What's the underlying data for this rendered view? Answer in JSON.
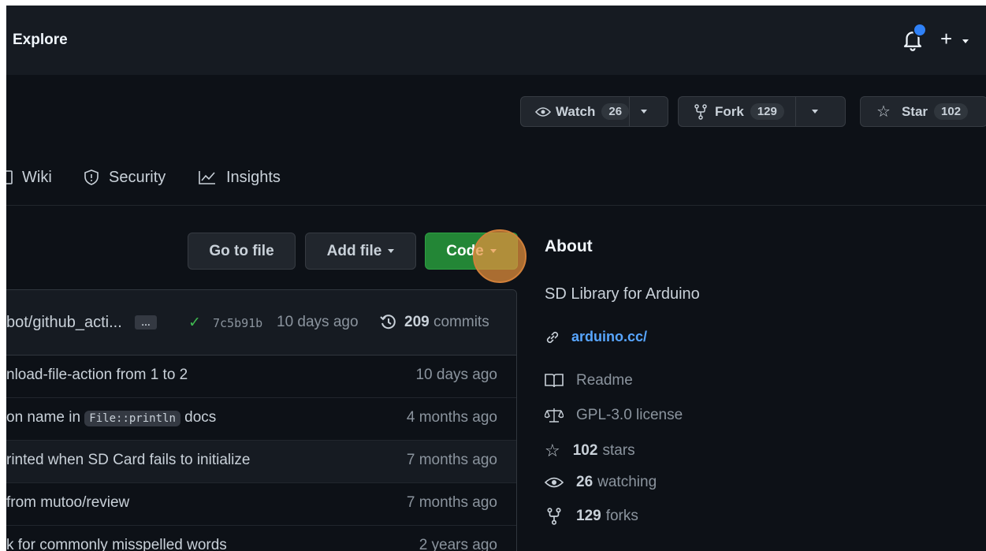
{
  "header": {
    "explore_label": "Explore",
    "icons": [
      "bell-icon",
      "plus-icon",
      "chevron-down-icon"
    ],
    "accent_color": "#2f81f7"
  },
  "repo_actions": {
    "watch": {
      "label": "Watch",
      "count": "26"
    },
    "fork": {
      "label": "Fork",
      "count": "129"
    },
    "star": {
      "label": "Star",
      "count": "102"
    }
  },
  "tabs": [
    {
      "label": "Wiki",
      "icon": "book-icon"
    },
    {
      "label": "Security",
      "icon": "shield-icon"
    },
    {
      "label": "Insights",
      "icon": "graph-icon"
    }
  ],
  "file_actions": {
    "go_to_file": "Go to file",
    "add_file": "Add file",
    "code": "Code",
    "code_color": "#238636"
  },
  "latest_commit": {
    "message": "bot/github_acti...",
    "ellipsis": "…",
    "hash": "7c5b91b",
    "age": "10 days ago",
    "commit_count": "209",
    "commits_label": "commits"
  },
  "rows": [
    {
      "message": "nload-file-action from 1 to 2",
      "age": "10 days ago"
    },
    {
      "message_pre": "on name in ",
      "code": "File::println",
      "message_post": " docs",
      "age": "4 months ago"
    },
    {
      "message": "rinted when SD Card fails to initialize",
      "age": "7 months ago"
    },
    {
      "message": "from mutoo/review",
      "age": "7 months ago"
    },
    {
      "message": "k for commonly misspelled words",
      "age": "2 years ago"
    }
  ],
  "about": {
    "title": "About",
    "description": "SD Library for Arduino",
    "website": "arduino.cc/",
    "readme": "Readme",
    "license": "GPL-3.0 license",
    "stars_count": "102",
    "stars_label": "stars",
    "watching_count": "26",
    "watching_label": "watching",
    "forks_count": "129",
    "forks_label": "forks"
  }
}
